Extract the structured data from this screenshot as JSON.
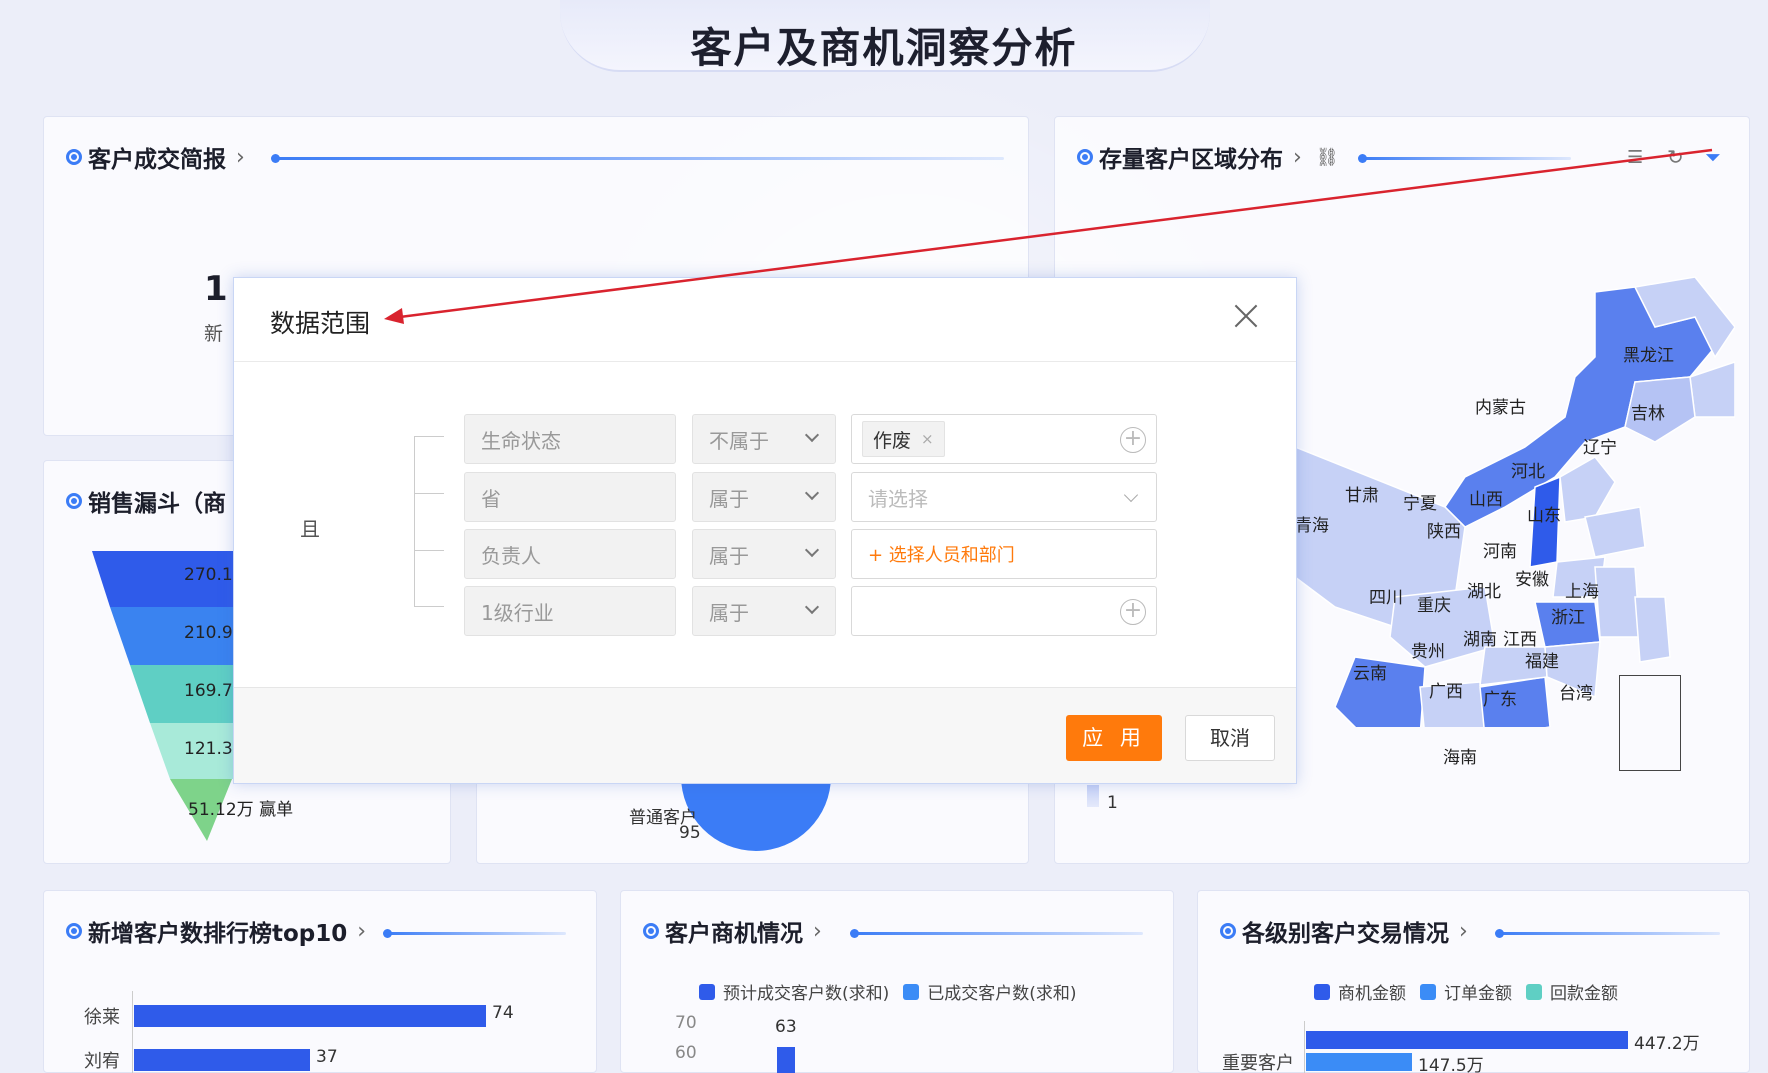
{
  "page_title": "客户及商机洞察分析",
  "cards": {
    "deal_report": {
      "title": "客户成交简报",
      "metric_value": "1",
      "metric_label": "新"
    },
    "region": {
      "title": "存量客户区域分布",
      "legend_min": "1"
    },
    "funnel": {
      "title": "销售漏斗（商",
      "stages": [
        "270.1",
        "210.9",
        "169.7",
        "121.34",
        "51.12万 赢单"
      ],
      "colors": [
        "#2f5bea",
        "#3a83f0",
        "#5fcfc4",
        "#a8ead9",
        "#7ed38a"
      ]
    },
    "pie": {
      "label": "普通客户",
      "value": "95"
    },
    "rank": {
      "title": "新增客户数排行榜top10",
      "rows": [
        {
          "name": "徐莱",
          "value": "74"
        },
        {
          "name": "刘宥",
          "value": "37"
        }
      ]
    },
    "opportunity": {
      "title": "客户商机情况",
      "legend": [
        "预计成交客户数(求和)",
        "已成交客户数(求和)"
      ],
      "y_ticks": [
        "70",
        "60"
      ],
      "bar_label": "63"
    },
    "level_trade": {
      "title": "各级别客户交易情况",
      "legend": [
        "商机金额",
        "订单金额",
        "回款金额"
      ],
      "category": "重要客户",
      "value1": "447.2万",
      "value2": "147.5万"
    }
  },
  "map_labels": [
    "黑龙江",
    "吉林",
    "辽宁",
    "内蒙古",
    "河北",
    "山西",
    "山东",
    "甘肃",
    "宁夏",
    "青海",
    "陕西",
    "河南",
    "四川",
    "重庆",
    "湖北",
    "安徽",
    "上海",
    "浙江",
    "贵州",
    "湖南",
    "江西",
    "福建",
    "云南",
    "广西",
    "广东",
    "台湾",
    "海南"
  ],
  "modal": {
    "title": "数据范围",
    "logic": "且",
    "rows": [
      {
        "field": "生命状态",
        "operator": "不属于",
        "value_tag": "作废"
      },
      {
        "field": "省",
        "operator": "属于",
        "placeholder": "请选择"
      },
      {
        "field": "负责人",
        "operator": "属于",
        "action": "+ 选择人员和部门"
      },
      {
        "field": "1级行业",
        "operator": "属于"
      }
    ],
    "apply_label": "应 用",
    "cancel_label": "取消"
  },
  "colors": {
    "accent": "#3b7cf6",
    "apply": "#ff7a0c",
    "annotation_arrow": "#d9232e"
  }
}
